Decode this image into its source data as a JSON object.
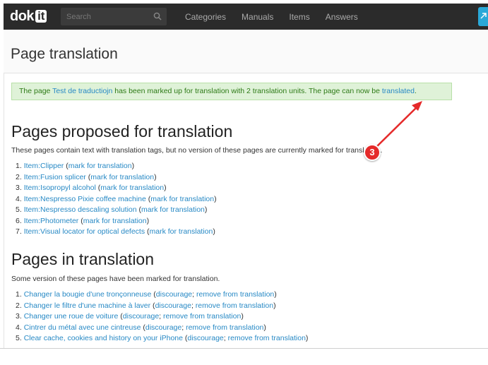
{
  "nav": {
    "logo_text": "dok",
    "logo_box": "it",
    "search_placeholder": "Search",
    "links": [
      "Categories",
      "Manuals",
      "Items",
      "Answers"
    ]
  },
  "header": {
    "title": "Page translation"
  },
  "notice": {
    "prefix": "The page ",
    "page_link": "Test de traductiojn",
    "middle": " has been marked up for translation with 2 translation units. The page can now be ",
    "translated_link": "translated",
    "suffix": "."
  },
  "proposed": {
    "heading": "Pages proposed for translation",
    "description": "These pages contain text with translation tags, but no version of these pages are currently marked for translation.",
    "items": [
      {
        "num": "1.",
        "page": "Item:Clipper",
        "action": "mark for translation"
      },
      {
        "num": "2.",
        "page": "Item:Fusion splicer",
        "action": "mark for translation"
      },
      {
        "num": "3.",
        "page": "Item:Isopropyl alcohol",
        "action": "mark for translation"
      },
      {
        "num": "4.",
        "page": "Item:Nespresso Pixie coffee machine",
        "action": "mark for translation"
      },
      {
        "num": "5.",
        "page": "Item:Nespresso descaling solution",
        "action": "mark for translation"
      },
      {
        "num": "6.",
        "page": "Item:Photometer",
        "action": "mark for translation"
      },
      {
        "num": "7.",
        "page": "Item:Visual locator for optical defects",
        "action": "mark for translation"
      }
    ]
  },
  "in_translation": {
    "heading": "Pages in translation",
    "description": "Some version of these pages have been marked for translation.",
    "items": [
      {
        "num": "1.",
        "page": "Changer la bougie d'une tronçonneuse",
        "a1": "discourage",
        "a2": "remove from translation"
      },
      {
        "num": "2.",
        "page": "Changer le filtre d'une machine à laver",
        "a1": "discourage",
        "a2": "remove from translation"
      },
      {
        "num": "3.",
        "page": "Changer une roue de voiture",
        "a1": "discourage",
        "a2": "remove from translation"
      },
      {
        "num": "4.",
        "page": "Cintrer du métal avec une cintreuse",
        "a1": "discourage",
        "a2": "remove from translation"
      },
      {
        "num": "5.",
        "page": "Clear cache, cookies and history on your iPhone",
        "a1": "discourage",
        "a2": "remove from translation"
      }
    ]
  },
  "annotation": {
    "step": "3",
    "color": "#e52a2a"
  },
  "colors": {
    "link": "#2789c5",
    "notice_bg": "#dff2d8",
    "notice_text": "#2d7a16",
    "nav_bg": "#2b2b2b"
  }
}
